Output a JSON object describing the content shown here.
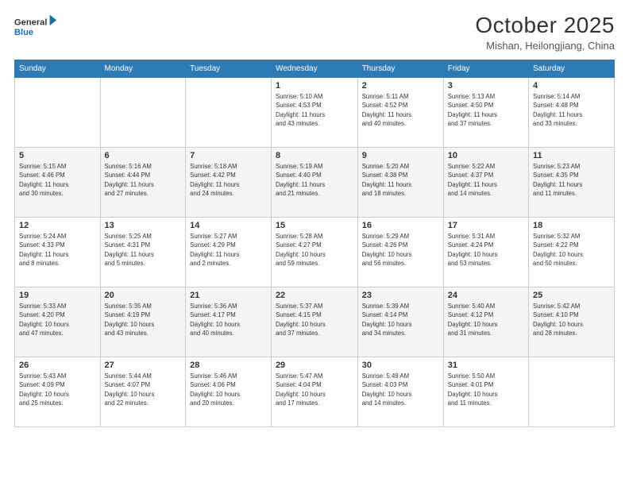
{
  "header": {
    "logo_line1": "General",
    "logo_line2": "Blue",
    "month_title": "October 2025",
    "location": "Mishan, Heilongjiang, China"
  },
  "calendar": {
    "days_of_week": [
      "Sunday",
      "Monday",
      "Tuesday",
      "Wednesday",
      "Thursday",
      "Friday",
      "Saturday"
    ],
    "weeks": [
      [
        {
          "day": "",
          "info": ""
        },
        {
          "day": "",
          "info": ""
        },
        {
          "day": "",
          "info": ""
        },
        {
          "day": "1",
          "info": "Sunrise: 5:10 AM\nSunset: 4:53 PM\nDaylight: 11 hours\nand 43 minutes."
        },
        {
          "day": "2",
          "info": "Sunrise: 5:11 AM\nSunset: 4:52 PM\nDaylight: 11 hours\nand 40 minutes."
        },
        {
          "day": "3",
          "info": "Sunrise: 5:13 AM\nSunset: 4:50 PM\nDaylight: 11 hours\nand 37 minutes."
        },
        {
          "day": "4",
          "info": "Sunrise: 5:14 AM\nSunset: 4:48 PM\nDaylight: 11 hours\nand 33 minutes."
        }
      ],
      [
        {
          "day": "5",
          "info": "Sunrise: 5:15 AM\nSunset: 4:46 PM\nDaylight: 11 hours\nand 30 minutes."
        },
        {
          "day": "6",
          "info": "Sunrise: 5:16 AM\nSunset: 4:44 PM\nDaylight: 11 hours\nand 27 minutes."
        },
        {
          "day": "7",
          "info": "Sunrise: 5:18 AM\nSunset: 4:42 PM\nDaylight: 11 hours\nand 24 minutes."
        },
        {
          "day": "8",
          "info": "Sunrise: 5:19 AM\nSunset: 4:40 PM\nDaylight: 11 hours\nand 21 minutes."
        },
        {
          "day": "9",
          "info": "Sunrise: 5:20 AM\nSunset: 4:38 PM\nDaylight: 11 hours\nand 18 minutes."
        },
        {
          "day": "10",
          "info": "Sunrise: 5:22 AM\nSunset: 4:37 PM\nDaylight: 11 hours\nand 14 minutes."
        },
        {
          "day": "11",
          "info": "Sunrise: 5:23 AM\nSunset: 4:35 PM\nDaylight: 11 hours\nand 11 minutes."
        }
      ],
      [
        {
          "day": "12",
          "info": "Sunrise: 5:24 AM\nSunset: 4:33 PM\nDaylight: 11 hours\nand 8 minutes."
        },
        {
          "day": "13",
          "info": "Sunrise: 5:25 AM\nSunset: 4:31 PM\nDaylight: 11 hours\nand 5 minutes."
        },
        {
          "day": "14",
          "info": "Sunrise: 5:27 AM\nSunset: 4:29 PM\nDaylight: 11 hours\nand 2 minutes."
        },
        {
          "day": "15",
          "info": "Sunrise: 5:28 AM\nSunset: 4:27 PM\nDaylight: 10 hours\nand 59 minutes."
        },
        {
          "day": "16",
          "info": "Sunrise: 5:29 AM\nSunset: 4:26 PM\nDaylight: 10 hours\nand 56 minutes."
        },
        {
          "day": "17",
          "info": "Sunrise: 5:31 AM\nSunset: 4:24 PM\nDaylight: 10 hours\nand 53 minutes."
        },
        {
          "day": "18",
          "info": "Sunrise: 5:32 AM\nSunset: 4:22 PM\nDaylight: 10 hours\nand 50 minutes."
        }
      ],
      [
        {
          "day": "19",
          "info": "Sunrise: 5:33 AM\nSunset: 4:20 PM\nDaylight: 10 hours\nand 47 minutes."
        },
        {
          "day": "20",
          "info": "Sunrise: 5:35 AM\nSunset: 4:19 PM\nDaylight: 10 hours\nand 43 minutes."
        },
        {
          "day": "21",
          "info": "Sunrise: 5:36 AM\nSunset: 4:17 PM\nDaylight: 10 hours\nand 40 minutes."
        },
        {
          "day": "22",
          "info": "Sunrise: 5:37 AM\nSunset: 4:15 PM\nDaylight: 10 hours\nand 37 minutes."
        },
        {
          "day": "23",
          "info": "Sunrise: 5:39 AM\nSunset: 4:14 PM\nDaylight: 10 hours\nand 34 minutes."
        },
        {
          "day": "24",
          "info": "Sunrise: 5:40 AM\nSunset: 4:12 PM\nDaylight: 10 hours\nand 31 minutes."
        },
        {
          "day": "25",
          "info": "Sunrise: 5:42 AM\nSunset: 4:10 PM\nDaylight: 10 hours\nand 28 minutes."
        }
      ],
      [
        {
          "day": "26",
          "info": "Sunrise: 5:43 AM\nSunset: 4:09 PM\nDaylight: 10 hours\nand 25 minutes."
        },
        {
          "day": "27",
          "info": "Sunrise: 5:44 AM\nSunset: 4:07 PM\nDaylight: 10 hours\nand 22 minutes."
        },
        {
          "day": "28",
          "info": "Sunrise: 5:46 AM\nSunset: 4:06 PM\nDaylight: 10 hours\nand 20 minutes."
        },
        {
          "day": "29",
          "info": "Sunrise: 5:47 AM\nSunset: 4:04 PM\nDaylight: 10 hours\nand 17 minutes."
        },
        {
          "day": "30",
          "info": "Sunrise: 5:49 AM\nSunset: 4:03 PM\nDaylight: 10 hours\nand 14 minutes."
        },
        {
          "day": "31",
          "info": "Sunrise: 5:50 AM\nSunset: 4:01 PM\nDaylight: 10 hours\nand 11 minutes."
        },
        {
          "day": "",
          "info": ""
        }
      ]
    ]
  }
}
